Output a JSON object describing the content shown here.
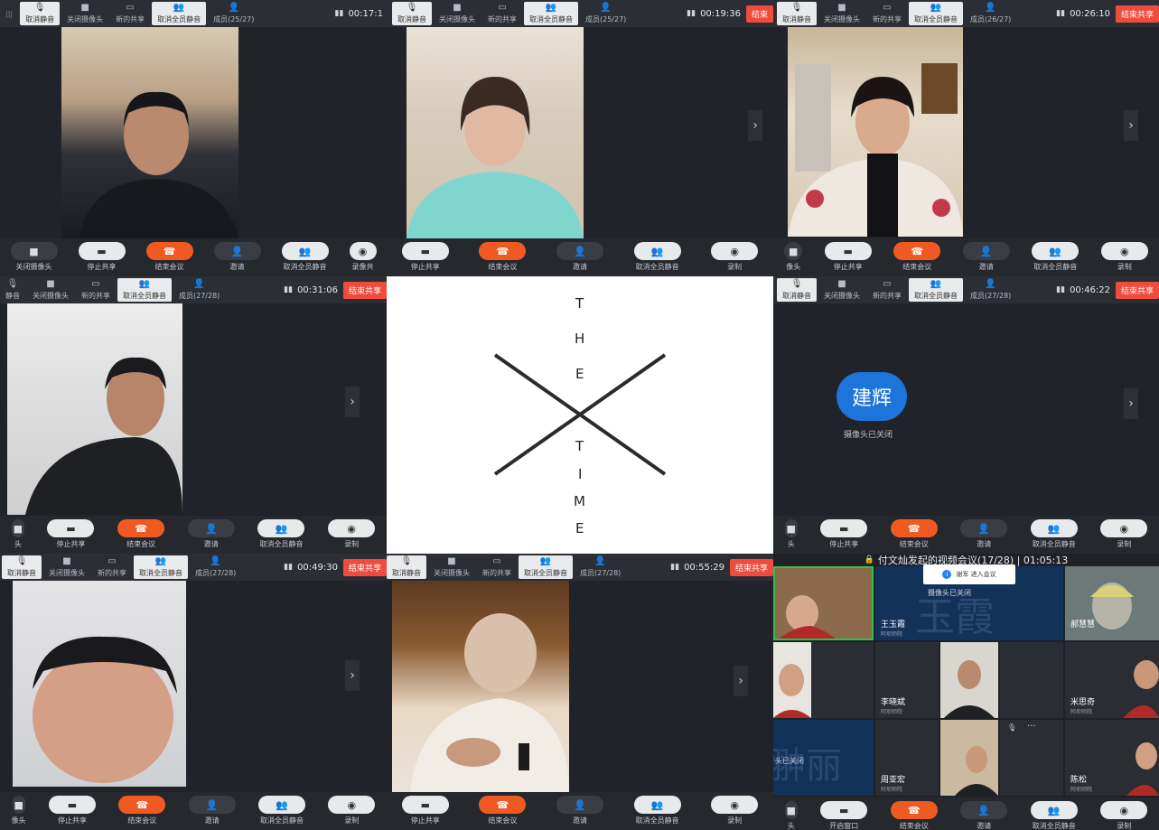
{
  "topbar_labels": {
    "mute_cancel": "取消静音",
    "mute_cancel_short": "静音",
    "camera_off": "关闭摄像头",
    "new_share": "新的共享",
    "unmute_all": "取消全员静音",
    "end_share": "结束共享",
    "end_share_short": "结束"
  },
  "bottombar_labels": {
    "camera_off": "关闭摄像头",
    "stop_share": "停止共享",
    "end_meeting": "结束会议",
    "invite": "邀请",
    "unmute_all": "取消全员静音",
    "record": "录制",
    "record_share": "录像共",
    "camera_tail": "像头",
    "camera_tail2": "头"
  },
  "panels": [
    {
      "members": "成员(25/27)",
      "timer": "00:17:1"
    },
    {
      "members": "成员(25/27)",
      "timer": "00:19:36"
    },
    {
      "members": "成员(26/27)",
      "timer": "00:26:10"
    },
    {
      "members": "成员(27/28)",
      "timer": "00:31:06"
    },
    {
      "members": "成员(27/28)",
      "timer": "00:46:22"
    },
    {
      "members": "成员(27/28)",
      "timer": "00:49:30"
    },
    {
      "members": "成员(27/28)",
      "timer": "00:55:29"
    }
  ],
  "avatar_panel": {
    "name": "建辉",
    "status": "摄像头已关闭"
  },
  "center_card": {
    "word1": [
      "T",
      "H",
      "E"
    ],
    "word2": [
      "T",
      "I",
      "M",
      "E"
    ]
  },
  "grid_meeting": {
    "title": "付文灿发起的视频会议(17/28) | 01:05:13",
    "toast": "谢军 进入会议",
    "tiles": [
      {
        "name": "王玉霞",
        "sub": "阿坝师院",
        "bg_text": "玉霞",
        "status": "摄像头已关闭"
      },
      {
        "name": "郝慧慧",
        "sub": "阿坝师院"
      },
      {
        "name": "李晓斌",
        "sub": "阿坝师院"
      },
      {
        "name": "米思奇",
        "sub": "阿坝师院"
      },
      {
        "name": "周亚宏",
        "sub": "阿坝师院"
      },
      {
        "name": "陈松",
        "sub": "阿坝师院"
      },
      {
        "bg_text": "翀丽",
        "status": "头已关闭"
      }
    ],
    "bottom": {
      "float_window": "开启窗口",
      "end": "结束会议",
      "invite": "邀请",
      "unmute_all": "取消全员静音",
      "record": "录制",
      "tail": "头"
    }
  }
}
